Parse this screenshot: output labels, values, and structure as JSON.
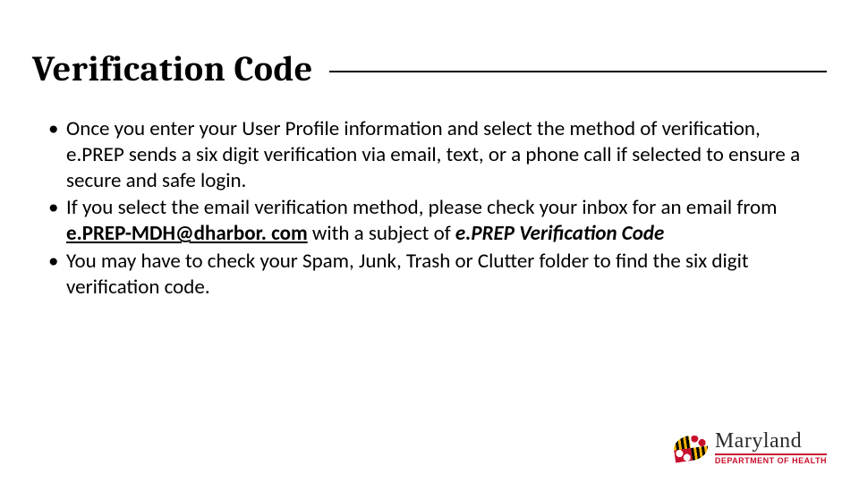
{
  "title": "Verification Code",
  "bullets": {
    "b1": "Once you enter your User Profile information and select the method of verification, e.PREP sends a six digit verification via email, text, or a phone call if selected  to ensure a secure and safe login.",
    "b2_pre": "If you select the email verification method, please check your inbox for an email from ",
    "b2_email": "e.PREP-MDH@dharbor. com",
    "b2_mid": " with a subject of ",
    "b2_subject": "e.PREP Verification Code",
    "b3": "You may have to check your Spam, Junk, Trash or Clutter folder to find the six digit verification code."
  },
  "logo": {
    "main": "Maryland",
    "sub": "DEPARTMENT OF HEALTH"
  }
}
